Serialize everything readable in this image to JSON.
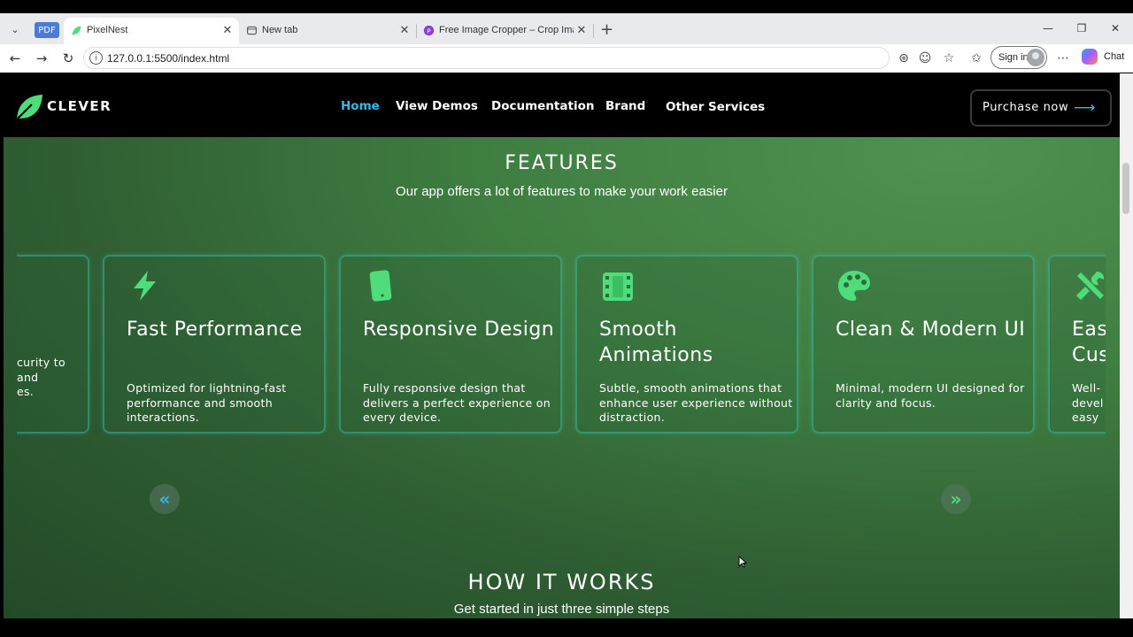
{
  "browser": {
    "tabs": [
      {
        "title": "PixelNest",
        "active": true
      },
      {
        "title": "New tab",
        "active": false
      },
      {
        "title": "Free Image Cropper – Crop Image",
        "active": false
      }
    ],
    "pdf_badge": "PDF",
    "url": "127.0.0.1:5500/index.html",
    "signin_label": "Sign in",
    "chat_label": "Chat"
  },
  "site": {
    "logo_text": "CLEVER",
    "nav": [
      {
        "label": "Home",
        "active": true
      },
      {
        "label": "View Demos",
        "active": false
      },
      {
        "label": "Documentation",
        "active": false
      },
      {
        "label": "Brand",
        "active": false
      },
      {
        "label": "Other Services",
        "active": false
      }
    ],
    "purchase_label": "Purchase now",
    "accent_color": "#35b9e6",
    "icon_color": "#4fdc7a"
  },
  "features": {
    "title": "FEATURES",
    "subtitle": "Our app offers a lot of features to make your work easier",
    "cards": [
      {
        "icon": "shield-icon",
        "title": "",
        "desc": "curity to\nand\nes."
      },
      {
        "icon": "lightning-icon",
        "title": "Fast Performance",
        "desc": "Optimized for lightning-fast performance and smooth interactions."
      },
      {
        "icon": "mobile-icon",
        "title": "Responsive Design",
        "desc": "Fully responsive design that delivers a perfect experience on every device."
      },
      {
        "icon": "film-icon",
        "title": "Smooth Animations",
        "desc": "Subtle, smooth animations that enhance user experience without distraction."
      },
      {
        "icon": "palette-icon",
        "title": "Clean & Modern UI",
        "desc": "Minimal, modern UI designed for clarity and focus."
      },
      {
        "icon": "tools-icon",
        "title": "Eas\nCus",
        "desc": "Well-\ndevel\neasy"
      }
    ]
  },
  "how_it_works": {
    "title": "HOW IT WORKS",
    "subtitle": "Get started in just three simple steps"
  }
}
